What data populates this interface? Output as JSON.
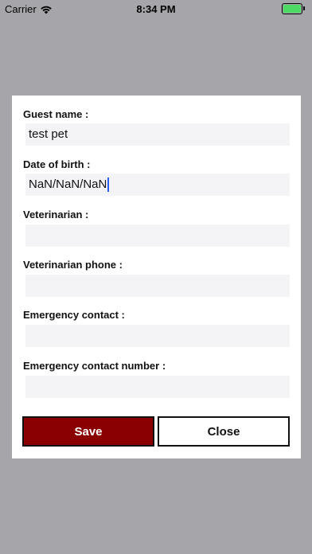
{
  "status_bar": {
    "carrier": "Carrier",
    "time": "8:34 PM",
    "icons": [
      "wifi-icon",
      "battery-icon"
    ],
    "battery_color": "#4cd964"
  },
  "form": {
    "guest_name": {
      "label": "Guest name :",
      "value": "test pet"
    },
    "date_of_birth": {
      "label": "Date of birth :",
      "value": "NaN/NaN/NaN"
    },
    "veterinarian": {
      "label": "Veterinarian :",
      "value": ""
    },
    "veterinarian_phone": {
      "label": "Veterinarian phone :",
      "value": ""
    },
    "emergency_contact": {
      "label": "Emergency contact :",
      "value": ""
    },
    "emergency_contact_number": {
      "label": "Emergency contact number :",
      "value": ""
    }
  },
  "buttons": {
    "save_label": "Save",
    "close_label": "Close",
    "save_color": "#8a0000"
  },
  "colors": {
    "backdrop": "#a6a5a9",
    "input_bg": "#f4f4f6"
  }
}
